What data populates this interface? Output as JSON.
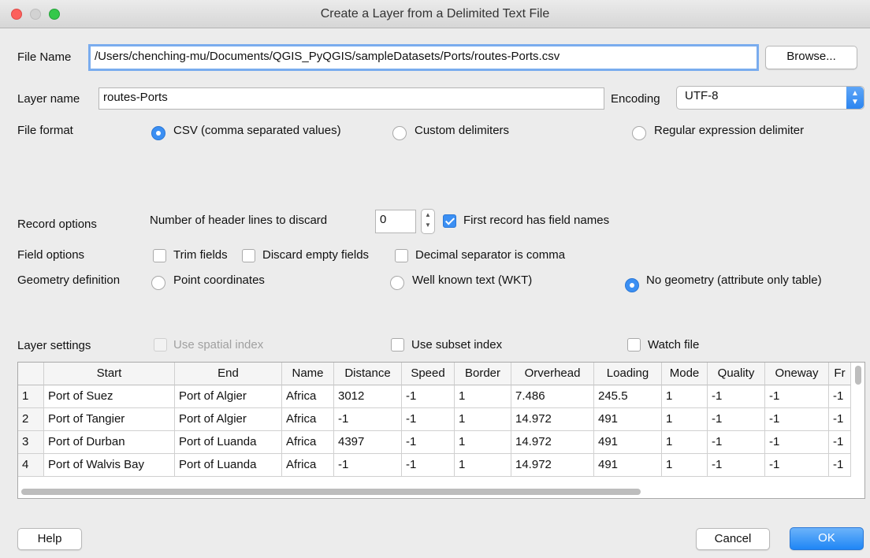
{
  "window": {
    "title": "Create a Layer from a Delimited Text File"
  },
  "file": {
    "label": "File Name",
    "value": "/Users/chenching-mu/Documents/QGIS_PyQGIS/sampleDatasets/Ports/routes-Ports.csv",
    "browse": "Browse..."
  },
  "layer": {
    "label": "Layer name",
    "value": "routes-Ports"
  },
  "encoding": {
    "label": "Encoding",
    "value": "UTF-8"
  },
  "format": {
    "label": "File format",
    "options": [
      "CSV (comma separated values)",
      "Custom delimiters",
      "Regular expression delimiter"
    ],
    "selected": 0
  },
  "record": {
    "label": "Record options",
    "header_lines_label": "Number of header lines to discard",
    "header_lines_value": "0",
    "first_record_label": "First record has field names",
    "first_record_checked": true
  },
  "field_opts": {
    "label": "Field options",
    "trim": "Trim fields",
    "discard": "Discard empty fields",
    "decimal": "Decimal separator is comma"
  },
  "geometry": {
    "label": "Geometry definition",
    "options": [
      "Point coordinates",
      "Well known text (WKT)",
      "No geometry (attribute only table)"
    ],
    "selected": 2
  },
  "settings": {
    "label": "Layer settings",
    "spatial": "Use spatial index",
    "subset": "Use subset index",
    "watch": "Watch file"
  },
  "table": {
    "columns": [
      "",
      "Start",
      "End",
      "Name",
      "Distance",
      "Speed",
      "Border",
      "Orverhead",
      "Loading",
      "Mode",
      "Quality",
      "Oneway",
      "Fr"
    ],
    "rows": [
      [
        "1",
        "Port of Suez",
        "Port of Algier",
        "Africa",
        "3012",
        "-1",
        "1",
        "7.486",
        "245.5",
        "1",
        "-1",
        "-1",
        "-1"
      ],
      [
        "2",
        "Port of Tangier",
        "Port of Algier",
        "Africa",
        "-1",
        "-1",
        "1",
        "14.972",
        "491",
        "1",
        "-1",
        "-1",
        "-1"
      ],
      [
        "3",
        "Port of Durban",
        "Port of Luanda",
        "Africa",
        "4397",
        "-1",
        "1",
        "14.972",
        "491",
        "1",
        "-1",
        "-1",
        "-1"
      ],
      [
        "4",
        "Port of Walvis Bay",
        "Port of Luanda",
        "Africa",
        "-1",
        "-1",
        "1",
        "14.972",
        "491",
        "1",
        "-1",
        "-1",
        "-1"
      ]
    ]
  },
  "buttons": {
    "help": "Help",
    "cancel": "Cancel",
    "ok": "OK"
  }
}
